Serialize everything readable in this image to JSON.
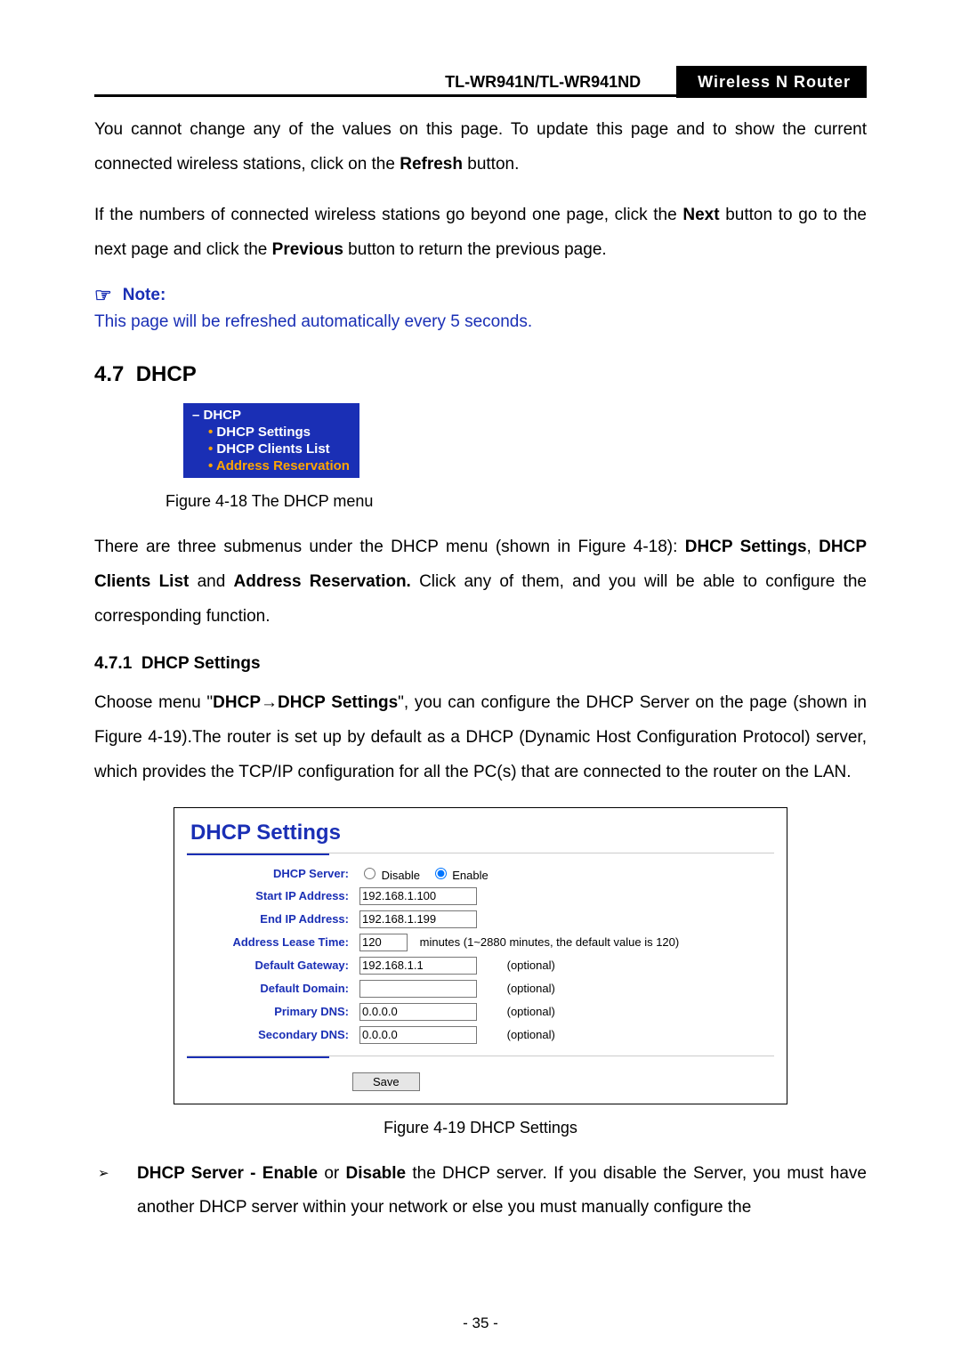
{
  "header": {
    "model": "TL-WR941N/TL-WR941ND",
    "product": "Wireless  N  Router"
  },
  "intro": {
    "p1a": "You cannot change any of the values on this page. To update this page and to show the current connected wireless stations, click on the ",
    "p1b": "Refresh",
    "p1c": " button.",
    "p2a": "If the numbers of connected wireless stations go beyond one page, click the ",
    "p2b": "Next",
    "p2c": " button to go to the next page and click the ",
    "p2d": "Previous",
    "p2e": " button to return the previous page."
  },
  "note": {
    "label": "Note:",
    "body": "This page will be refreshed automatically every 5 seconds."
  },
  "sec47": {
    "num": "4.7",
    "title": "DHCP",
    "menu": {
      "root": "DHCP",
      "items": [
        "DHCP Settings",
        "DHCP Clients List",
        "Address Reservation"
      ]
    },
    "fig18": "Figure 4-18    The DHCP menu",
    "para_a": "There are three submenus under the DHCP menu (shown in Figure 4-18): ",
    "para_b": "DHCP Settings",
    "para_c": ", ",
    "para_d": "DHCP Clients List",
    "para_e": " and ",
    "para_f": "Address Reservation.",
    "para_g": " Click any of them, and you will be able to configure the corresponding function."
  },
  "sec471": {
    "num": "4.7.1",
    "title": "DHCP Settings",
    "intro_a": "Choose menu \"",
    "intro_b": "DHCP",
    "intro_arrow": "→",
    "intro_c": "DHCP Settings",
    "intro_d": "\", you can configure the DHCP Server on the page (shown in Figure 4-19).The router is set up by default as a DHCP (Dynamic Host Configuration Protocol) server, which provides the TCP/IP configuration for all the PC(s) that are connected to the router on the LAN."
  },
  "settings": {
    "title": "DHCP Settings",
    "labels": {
      "server": "DHCP Server:",
      "start": "Start IP Address:",
      "end": "End IP Address:",
      "lease": "Address Lease Time:",
      "gateway": "Default Gateway:",
      "domain": "Default Domain:",
      "pdns": "Primary DNS:",
      "sdns": "Secondary DNS:"
    },
    "radio_disable": "Disable",
    "radio_enable": "Enable",
    "start_ip": "192.168.1.100",
    "end_ip": "192.168.1.199",
    "lease": "120",
    "lease_hint": "minutes (1~2880 minutes, the default value is 120)",
    "gateway": "192.168.1.1",
    "domain": "",
    "pdns": "0.0.0.0",
    "sdns": "0.0.0.0",
    "optional": "(optional)",
    "save": "Save"
  },
  "fig19": "Figure 4-19 DHCP Settings",
  "bullets": {
    "b1_bold": "DHCP Server - Enable ",
    "b1_mid": "or",
    "b1_bold2": " Disable ",
    "b1_rest": "the DHCP server. If you disable the Server, you must have another DHCP server within your network or else you must manually configure the"
  },
  "page_no": "- 35 -"
}
